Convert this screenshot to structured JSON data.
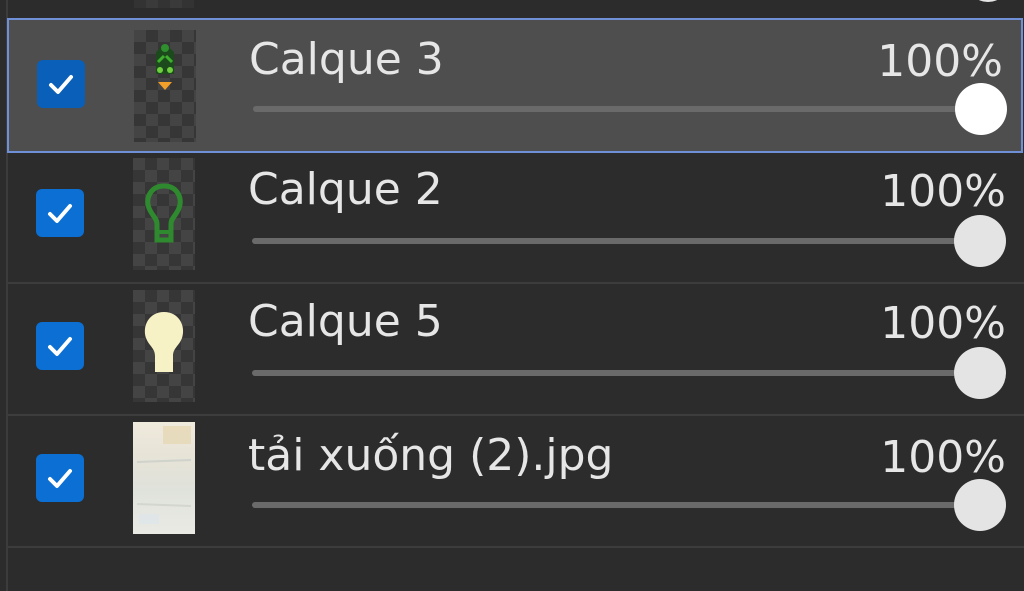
{
  "layers": [
    {
      "name": "Calque 3",
      "opacity": "100%",
      "opacity_value": 1.0,
      "visible": true,
      "selected": true,
      "thumb_icon": "green-creature-icon"
    },
    {
      "name": "Calque 2",
      "opacity": "100%",
      "opacity_value": 1.0,
      "visible": true,
      "selected": false,
      "thumb_icon": "green-outline-bulb-icon"
    },
    {
      "name": "Calque 5",
      "opacity": "100%",
      "opacity_value": 1.0,
      "visible": true,
      "selected": false,
      "thumb_icon": "cream-bulb-icon"
    },
    {
      "name": "tải xuống (2).jpg",
      "opacity": "100%",
      "opacity_value": 1.0,
      "visible": true,
      "selected": false,
      "thumb_icon": "photo-thumbnail"
    }
  ],
  "colors": {
    "panel_bg": "#2c2c2c",
    "selected_bg": "#4e4e4e",
    "selected_border": "#6f8fd6",
    "checkbox": "#0b6fd3",
    "text": "#e6e6e6"
  }
}
